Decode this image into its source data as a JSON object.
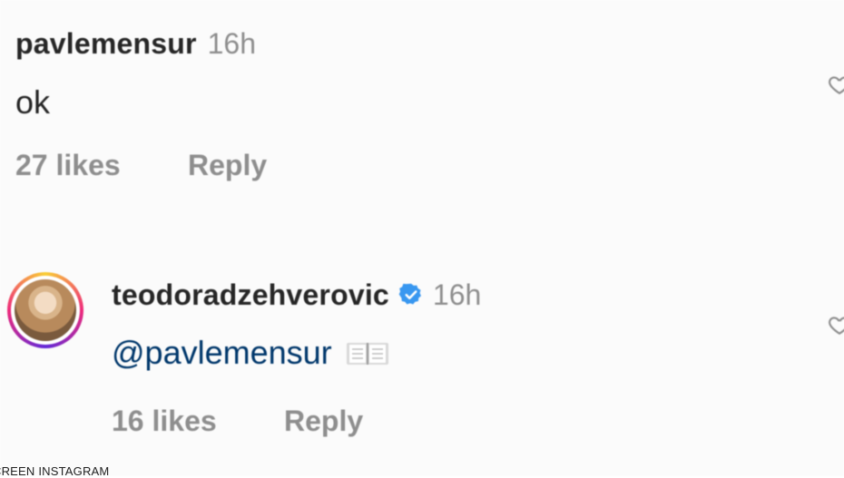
{
  "comments": [
    {
      "username": "pavlemensur",
      "time": "16h",
      "text": "ok",
      "likes": "27 likes",
      "reply_label": "Reply",
      "verified": false
    },
    {
      "username": "teodoradzehverovic",
      "time": "16h",
      "mention": "@pavlemensur",
      "emoji": "open-book-icon",
      "likes": "16 likes",
      "reply_label": "Reply",
      "verified": true
    }
  ],
  "icons": {
    "like": "heart-icon",
    "verified": "verified-badge-icon"
  },
  "colors": {
    "verified_blue": "#3897f0",
    "mention_blue": "#00376b",
    "secondary_text": "#8e8e8e",
    "primary_text": "#262626"
  },
  "watermark": "CREEN INSTAGRAM"
}
